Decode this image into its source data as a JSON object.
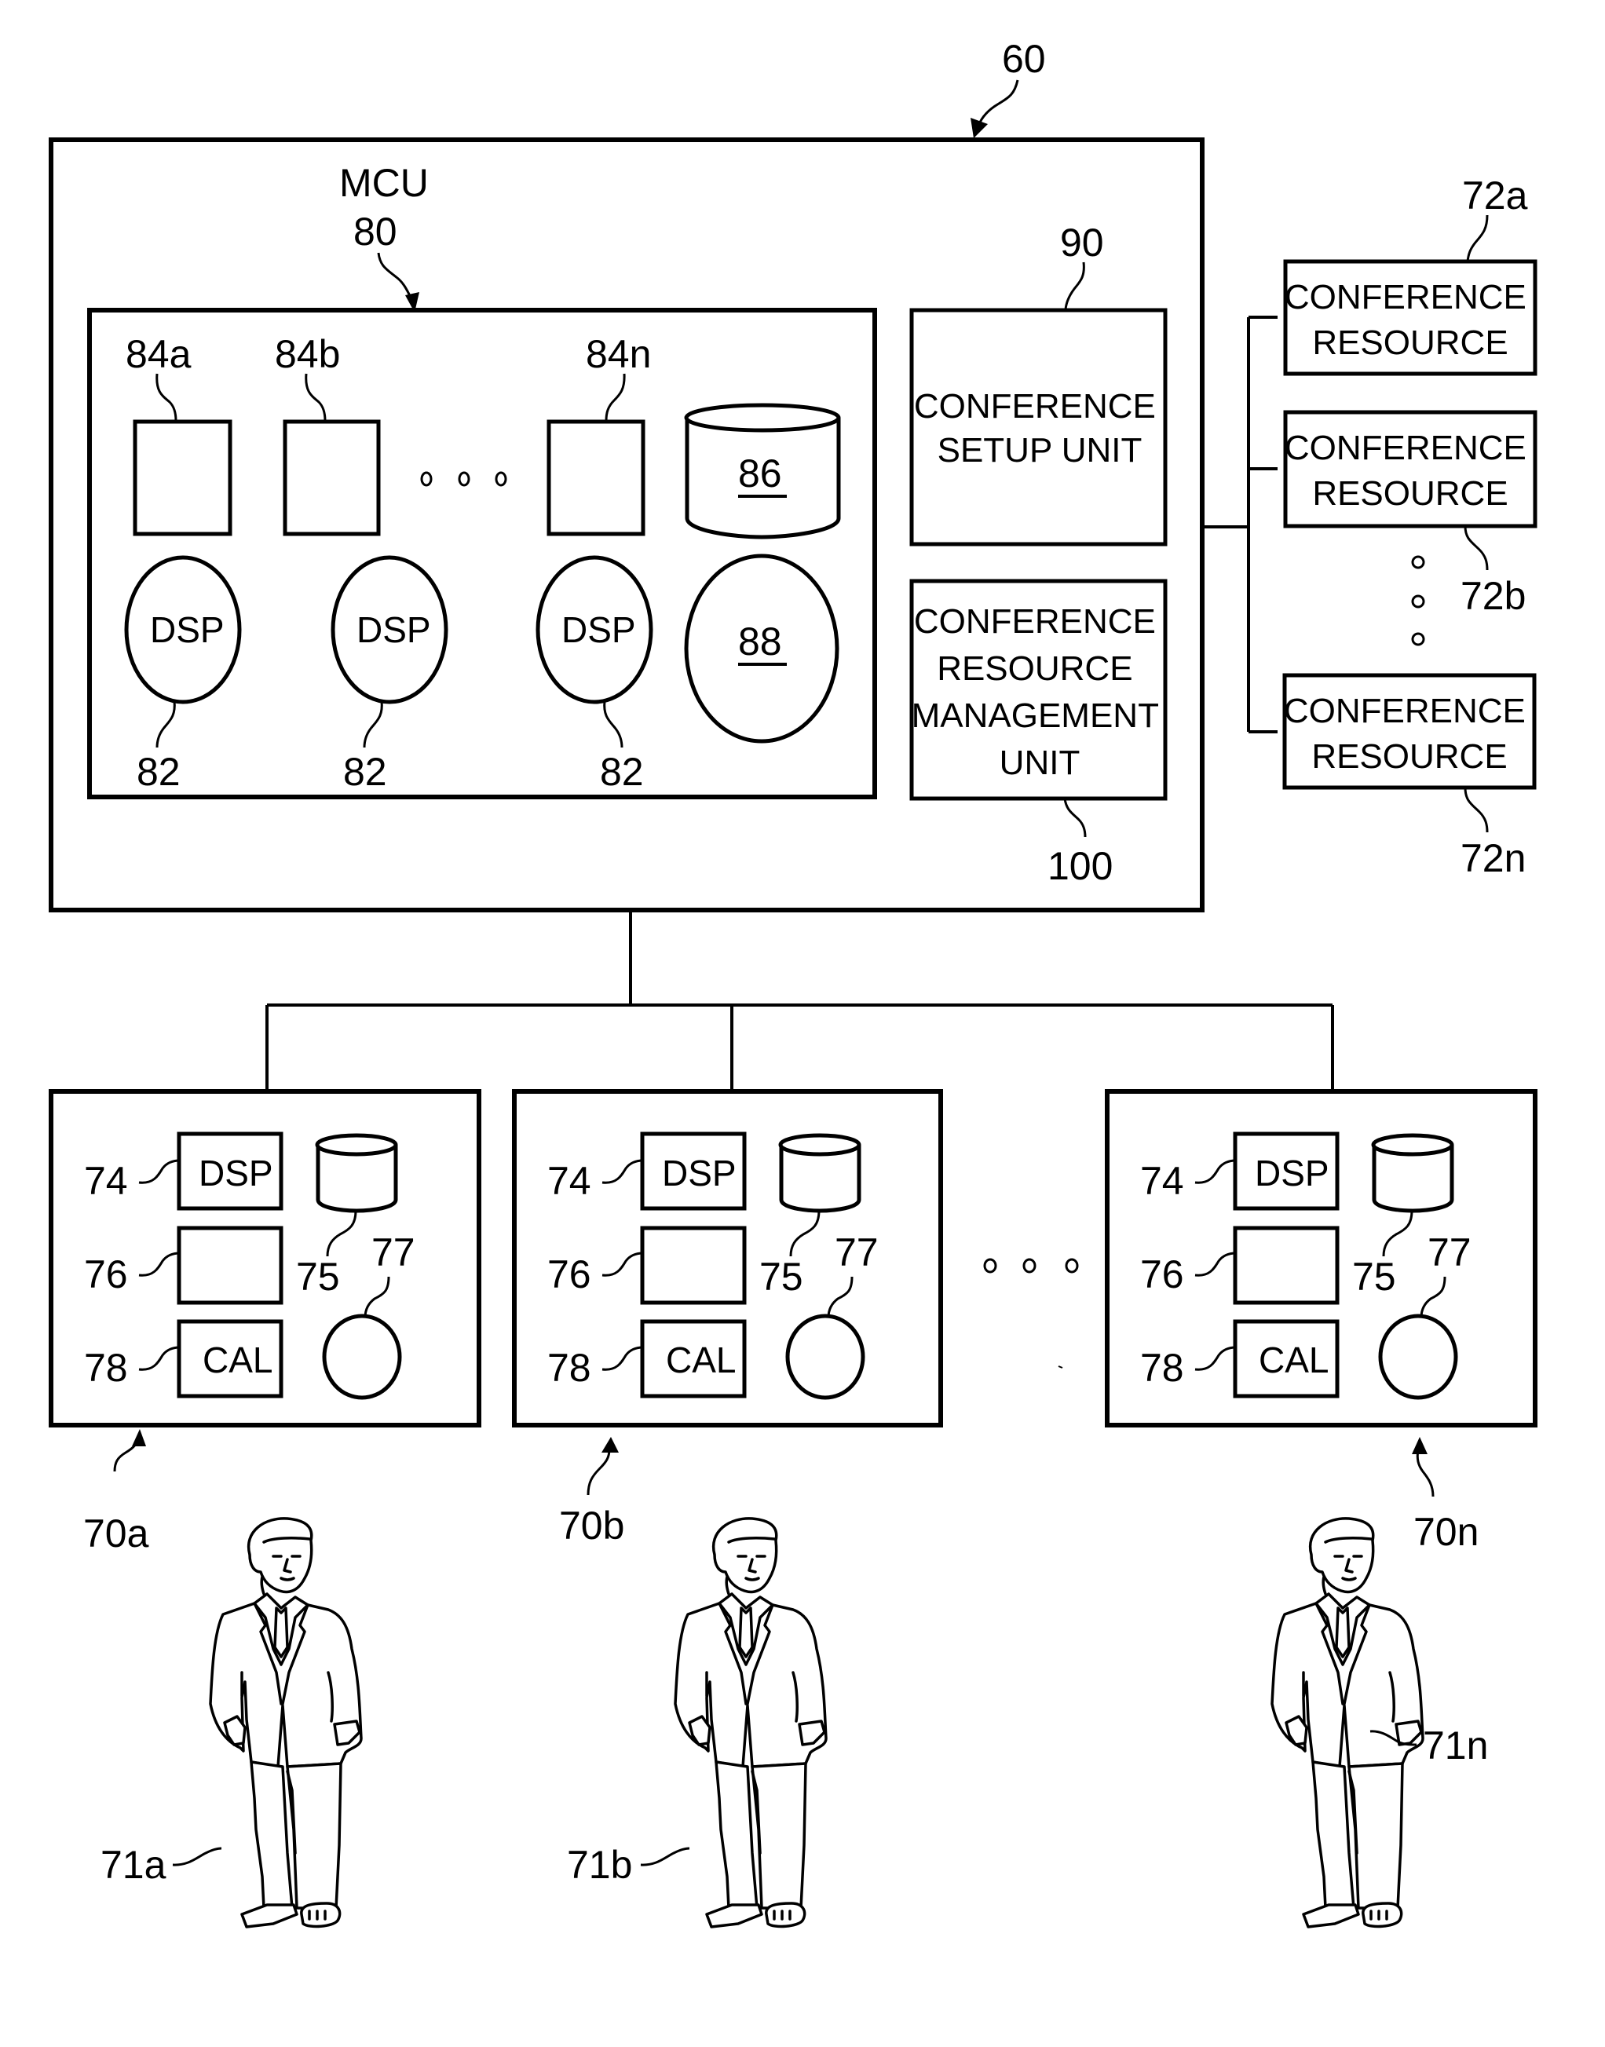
{
  "figure": {
    "system_ref": "60",
    "mcu": {
      "title": "MCU",
      "ref": "80",
      "resource_refs": [
        "84a",
        "84b",
        "84n"
      ],
      "dsp_label": "DSP",
      "dsp_ref": "82",
      "storage_ref": "86",
      "processor_ref": "88"
    },
    "setup_unit": {
      "ref": "90",
      "lines": [
        "CONFERENCE",
        "SETUP UNIT"
      ]
    },
    "resource_mgmt_unit": {
      "ref": "100",
      "lines": [
        "CONFERENCE",
        "RESOURCE",
        "MANAGEMENT",
        "UNIT"
      ]
    },
    "conference_resources": [
      {
        "ref": "72a",
        "lines": [
          "CONFERENCE",
          "RESOURCE"
        ]
      },
      {
        "ref": "72b",
        "lines": [
          "CONFERENCE",
          "RESOURCE"
        ]
      },
      {
        "ref": "72n",
        "lines": [
          "CONFERENCE",
          "RESOURCE"
        ]
      }
    ],
    "terminals": [
      {
        "ref": "70a",
        "user_ref": "71a"
      },
      {
        "ref": "70b",
        "user_ref": "71b"
      },
      {
        "ref": "70n",
        "user_ref": "71n"
      }
    ],
    "terminal_parts": {
      "dsp_ref": "74",
      "dsp_label": "DSP",
      "storage_ref": "75",
      "blank_ref": "76",
      "processor_ref": "77",
      "cal_ref": "78",
      "cal_label": "CAL"
    }
  }
}
